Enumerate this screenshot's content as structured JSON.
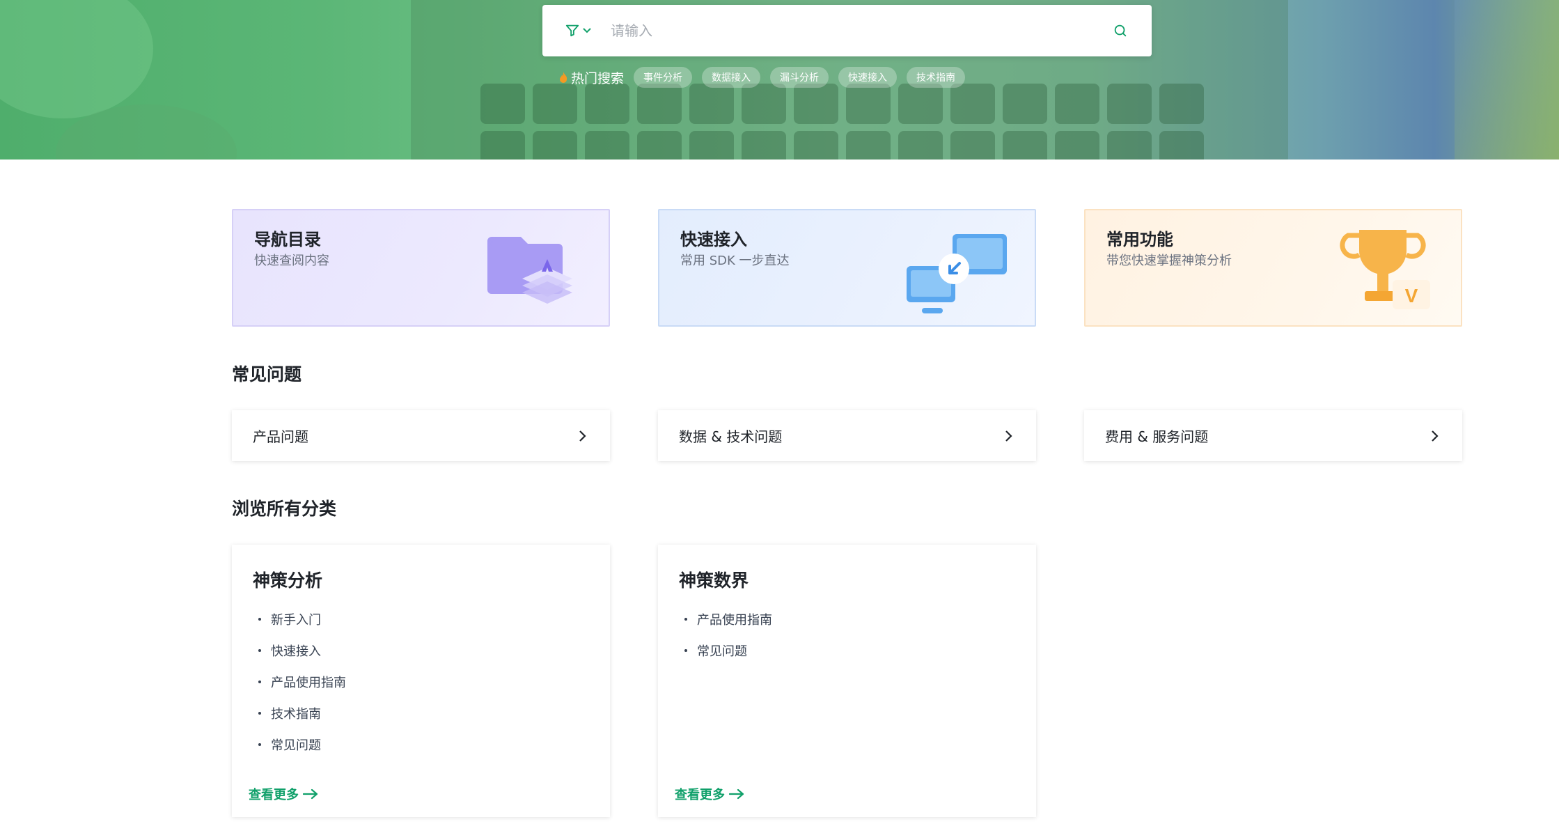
{
  "search": {
    "placeholder": "请输入",
    "hot_label": "热门搜索",
    "hot_tags": [
      "事件分析",
      "数据接入",
      "漏斗分析",
      "快速接入",
      "技术指南"
    ]
  },
  "features": [
    {
      "title": "导航目录",
      "subtitle": "快速查阅内容"
    },
    {
      "title": "快速接入",
      "subtitle": "常用 SDK 一步直达"
    },
    {
      "title": "常用功能",
      "subtitle": "带您快速掌握神策分析"
    }
  ],
  "faq": {
    "title": "常见问题",
    "items": [
      "产品问题",
      "数据 & 技术问题",
      "费用 & 服务问题"
    ]
  },
  "categories": {
    "title": "浏览所有分类",
    "cards": [
      {
        "title": "神策分析",
        "items": [
          "新手入门",
          "快速接入",
          "产品使用指南",
          "技术指南",
          "常见问题"
        ],
        "more": "查看更多"
      },
      {
        "title": "神策数界",
        "items": [
          "产品使用指南",
          "常见问题"
        ],
        "more": "查看更多"
      }
    ]
  },
  "colors": {
    "accent": "#10a06a",
    "hero_green": "#5bb676"
  },
  "trophy_badge": "V"
}
